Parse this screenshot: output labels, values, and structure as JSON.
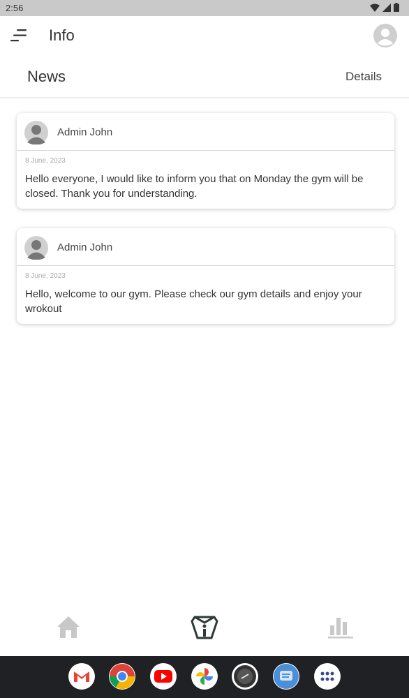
{
  "status": {
    "time": "2:56"
  },
  "app_bar": {
    "title": "Info"
  },
  "sub_header": {
    "title": "News",
    "details_label": "Details"
  },
  "posts": [
    {
      "author": "Admin John",
      "date": "8 June, 2023",
      "text": "Hello everyone, I would like to inform you that on Monday the gym will be closed. Thank you for understanding."
    },
    {
      "author": "Admin John",
      "date": "8 June, 2023",
      "text": "Hello, welcome to our gym. Please check our gym details and enjoy your wrokout"
    }
  ],
  "bottom_nav": [
    {
      "icon": "home-icon",
      "active": false
    },
    {
      "icon": "info-icon",
      "active": true
    },
    {
      "icon": "stats-icon",
      "active": false
    }
  ],
  "dock": [
    "gmail-icon",
    "chrome-icon",
    "youtube-icon",
    "photos-icon",
    "app-icon",
    "messages-icon",
    "app-drawer-icon"
  ]
}
